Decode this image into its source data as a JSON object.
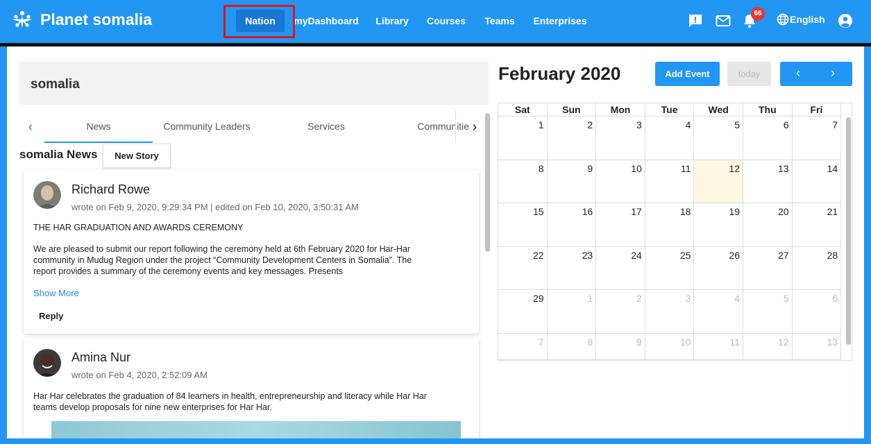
{
  "app": {
    "title": "Planet somalia"
  },
  "nav": {
    "items": [
      "Nation",
      "myDashboard",
      "Library",
      "Courses",
      "Teams",
      "Enterprises"
    ],
    "active": "Nation",
    "notification_count": "66",
    "language": "English"
  },
  "nation": {
    "name": "somalia",
    "tabs": [
      "News",
      "Community Leaders",
      "Services",
      "Communitie"
    ],
    "active_tab": "News",
    "news_title": "somalia News",
    "new_story_label": "New Story"
  },
  "posts": [
    {
      "author": "Richard Rowe",
      "meta": "wrote on Feb 9, 2020, 9:29:34 PM | edited on Feb 10, 2020, 3:50:31 AM",
      "heading": "THE HAR GRADUATION AND AWARDS CEREMONY",
      "body_line1": "We are pleased to submit our report following the ceremony held at 6th February 2020 for Har-Har",
      "body_line2": "community in Mudug Region under the project “Community Development Centers in Somalia”. The",
      "body_line3": "report provides a summary of the ceremony events and key messages. Presents",
      "show_more": "Show More",
      "reply": "Reply"
    },
    {
      "author": "Amina Nur",
      "meta": "wrote on Feb 4, 2020, 2:52:09 AM",
      "body_line1": "Har Har celebrates the graduation of 84 learners in health, entrepreneurship and literacy while Har Har",
      "body_line2": "teams develop proposals for nine new enterprises for Har Har."
    }
  ],
  "calendar": {
    "title": "February 2020",
    "add_event": "Add Event",
    "today": "today",
    "prev": "‹",
    "next": "›",
    "weekdays": [
      "Sat",
      "Sun",
      "Mon",
      "Tue",
      "Wed",
      "Thu",
      "Fri"
    ],
    "weeks": [
      [
        "1",
        "2",
        "3",
        "4",
        "5",
        "6",
        "7"
      ],
      [
        "8",
        "9",
        "10",
        "11",
        "12",
        "13",
        "14"
      ],
      [
        "15",
        "16",
        "17",
        "18",
        "19",
        "20",
        "21"
      ],
      [
        "22",
        "23",
        "24",
        "25",
        "26",
        "27",
        "28"
      ],
      [
        "29",
        "1",
        "2",
        "3",
        "4",
        "5",
        "6"
      ],
      [
        "7",
        "8",
        "9",
        "10",
        "11",
        "12",
        "13"
      ]
    ],
    "today_date": "12"
  }
}
